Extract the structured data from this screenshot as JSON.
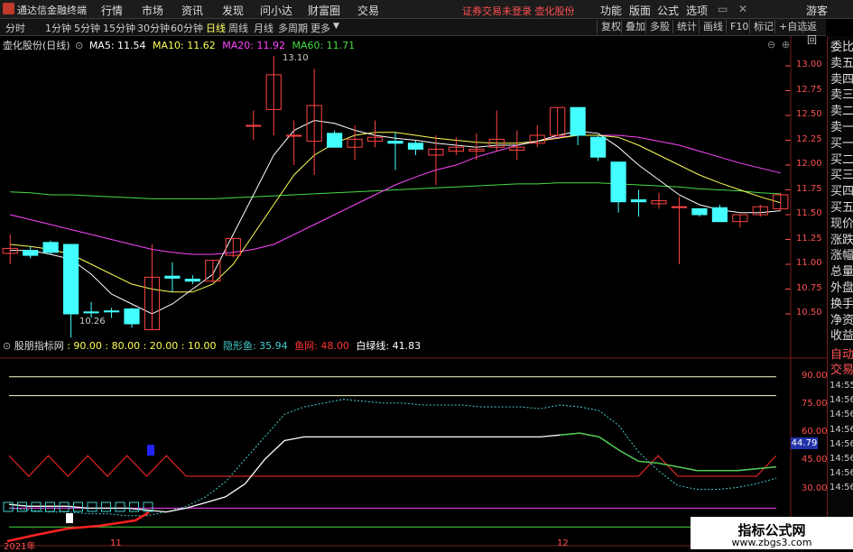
{
  "menubar": {
    "app": "通达信金融终端",
    "items": [
      "行情",
      "市场",
      "资讯",
      "发现",
      "问小达",
      "财富圈",
      "交易"
    ],
    "warning": "证券交易未登录  壶化股份",
    "right": [
      "功能",
      "版面",
      "公式",
      "选项"
    ],
    "guest": "游客"
  },
  "periodbar": {
    "items": [
      "分时",
      "1分钟",
      "5分钟",
      "15分钟",
      "30分钟",
      "60分钟",
      "日线",
      "周线",
      "月线",
      "多周期",
      "更多"
    ],
    "active": "日线",
    "tools": [
      "复权",
      "叠加",
      "多股",
      "统计",
      "画线",
      "F10",
      "标记",
      "+自选",
      "返回"
    ]
  },
  "main_legend": {
    "stock": "壶化股份(日线)",
    "ma5": "MA5: 11.54",
    "ma10": "MA10: 11.62",
    "ma20": "MA20: 11.92",
    "ma60": "MA60: 11.71",
    "hi_label": "13.10",
    "lo_label": "10.26"
  },
  "colors": {
    "up": "#ff4444",
    "down": "#44ffff",
    "ma5": "#ffffff",
    "ma10": "#ffff55",
    "ma20": "#ff44ff",
    "ma60": "#44dd44",
    "bg": "#000000"
  },
  "price_axis": [
    "13.00",
    "12.75",
    "12.50",
    "12.25",
    "12.00",
    "11.75",
    "11.50",
    "11.25",
    "11.00",
    "10.75",
    "10.50"
  ],
  "indicator_legend": {
    "name": "股朋指标网",
    "vals": ": 90.00 : 80.00 : 20.00 : 10.00",
    "yin": "隐形鱼: 35.94",
    "gou": "鱼网: 48.00",
    "bai": "白绿线: 41.83"
  },
  "indicator_axis": [
    "90.00",
    "75.00",
    "60.00",
    "45.00",
    "30.00"
  ],
  "indicator_current": "44.79",
  "date_axis": [
    "2021年",
    "11",
    "12"
  ],
  "rightpanel": [
    "委比",
    "卖五",
    "卖四",
    "卖三",
    "卖二",
    "卖一",
    "买一",
    "买二",
    "买三",
    "买四",
    "买五",
    "现价",
    "涨跌",
    "涨幅",
    "总量",
    "外盘",
    "换手",
    "净资",
    "收益"
  ],
  "rightpanel_bottom": [
    "自动",
    "交易"
  ],
  "rightpanel_times": [
    "14:55",
    "14:56",
    "14:56",
    "14:56",
    "14:56",
    "14:56",
    "14:56",
    "14:56"
  ],
  "watermark": {
    "title": "指标公式网",
    "url": "www.zbgs3.com"
  },
  "chart_data": {
    "type": "candlestick",
    "candles": [
      {
        "o": 11.11,
        "c": 11.16,
        "h": 11.3,
        "l": 11.0
      },
      {
        "o": 11.14,
        "c": 11.09,
        "h": 11.18,
        "l": 11.06
      },
      {
        "o": 11.22,
        "c": 11.12,
        "h": 11.24,
        "l": 11.1
      },
      {
        "o": 11.2,
        "c": 10.5,
        "h": 11.2,
        "l": 10.26
      },
      {
        "o": 10.52,
        "c": 10.51,
        "h": 10.62,
        "l": 10.46
      },
      {
        "o": 10.53,
        "c": 10.52,
        "h": 10.56,
        "l": 10.46
      },
      {
        "o": 10.55,
        "c": 10.4,
        "h": 10.56,
        "l": 10.36
      },
      {
        "o": 10.34,
        "c": 10.87,
        "h": 11.2,
        "l": 10.34
      },
      {
        "o": 10.88,
        "c": 10.86,
        "h": 11.02,
        "l": 10.72
      },
      {
        "o": 10.85,
        "c": 10.83,
        "h": 10.89,
        "l": 10.8
      },
      {
        "o": 10.83,
        "c": 11.04,
        "h": 11.04,
        "l": 10.82
      },
      {
        "o": 11.09,
        "c": 11.26,
        "h": 11.26,
        "l": 11.07
      },
      {
        "o": 12.4,
        "c": 12.4,
        "h": 12.55,
        "l": 12.25
      },
      {
        "o": 12.56,
        "c": 12.91,
        "h": 13.1,
        "l": 12.3
      },
      {
        "o": 12.3,
        "c": 12.3,
        "h": 12.45,
        "l": 12.0
      },
      {
        "o": 12.24,
        "c": 12.6,
        "h": 12.97,
        "l": 11.9
      },
      {
        "o": 12.32,
        "c": 12.18,
        "h": 12.35,
        "l": 12.18
      },
      {
        "o": 12.18,
        "c": 12.26,
        "h": 12.4,
        "l": 12.05
      },
      {
        "o": 12.24,
        "c": 12.28,
        "h": 12.45,
        "l": 12.18
      },
      {
        "o": 12.24,
        "c": 12.22,
        "h": 12.33,
        "l": 11.95
      },
      {
        "o": 12.22,
        "c": 12.16,
        "h": 12.25,
        "l": 12.1
      },
      {
        "o": 12.1,
        "c": 12.16,
        "h": 12.3,
        "l": 11.8
      },
      {
        "o": 12.14,
        "c": 12.18,
        "h": 12.28,
        "l": 12.1
      },
      {
        "o": 12.14,
        "c": 12.16,
        "h": 12.32,
        "l": 12.05
      },
      {
        "o": 12.18,
        "c": 12.26,
        "h": 12.55,
        "l": 12.14
      },
      {
        "o": 12.15,
        "c": 12.18,
        "h": 12.35,
        "l": 12.05
      },
      {
        "o": 12.22,
        "c": 12.3,
        "h": 12.4,
        "l": 12.18
      },
      {
        "o": 12.3,
        "c": 12.58,
        "h": 12.58,
        "l": 12.3
      },
      {
        "o": 12.58,
        "c": 12.3,
        "h": 12.58,
        "l": 12.2
      },
      {
        "o": 12.28,
        "c": 12.08,
        "h": 12.3,
        "l": 12.04
      },
      {
        "o": 12.03,
        "c": 11.63,
        "h": 12.03,
        "l": 11.52
      },
      {
        "o": 11.65,
        "c": 11.63,
        "h": 11.75,
        "l": 11.48
      },
      {
        "o": 11.61,
        "c": 11.64,
        "h": 11.72,
        "l": 11.56
      },
      {
        "o": 11.58,
        "c": 11.58,
        "h": 11.68,
        "l": 11.0
      },
      {
        "o": 11.56,
        "c": 11.5,
        "h": 11.56,
        "l": 11.48
      },
      {
        "o": 11.57,
        "c": 11.43,
        "h": 11.6,
        "l": 11.43
      },
      {
        "o": 11.43,
        "c": 11.5,
        "h": 11.5,
        "l": 11.37
      },
      {
        "o": 11.5,
        "c": 11.58,
        "h": 11.6,
        "l": 11.48
      },
      {
        "o": 11.56,
        "c": 11.7,
        "h": 11.72,
        "l": 11.54
      }
    ],
    "ma5": [
      11.14,
      11.14,
      11.1,
      11.05,
      10.9,
      10.7,
      10.6,
      10.5,
      10.6,
      10.75,
      10.9,
      11.3,
      11.7,
      12.1,
      12.35,
      12.45,
      12.42,
      12.35,
      12.3,
      12.27,
      12.25,
      12.22,
      12.2,
      12.18,
      12.2,
      12.2,
      12.24,
      12.3,
      12.34,
      12.32,
      12.18,
      12.0,
      11.85,
      11.7,
      11.6,
      11.55,
      11.52,
      11.52,
      11.54
    ],
    "ma10": [
      11.2,
      11.18,
      11.15,
      11.1,
      11.0,
      10.9,
      10.8,
      10.75,
      10.72,
      10.72,
      10.8,
      11.0,
      11.3,
      11.6,
      11.9,
      12.1,
      12.22,
      12.3,
      12.33,
      12.33,
      12.3,
      12.27,
      12.25,
      12.23,
      12.22,
      12.22,
      12.24,
      12.27,
      12.3,
      12.3,
      12.28,
      12.2,
      12.1,
      12.0,
      11.9,
      11.82,
      11.75,
      11.68,
      11.62
    ],
    "ma20": [
      11.5,
      11.45,
      11.4,
      11.35,
      11.3,
      11.25,
      11.2,
      11.15,
      11.12,
      11.1,
      11.1,
      11.12,
      11.15,
      11.2,
      11.3,
      11.4,
      11.5,
      11.6,
      11.7,
      11.8,
      11.88,
      11.95,
      12.0,
      12.08,
      12.14,
      12.2,
      12.24,
      12.28,
      12.3,
      12.3,
      12.3,
      12.28,
      12.24,
      12.2,
      12.14,
      12.08,
      12.02,
      11.97,
      11.92
    ],
    "ma60": [
      11.73,
      11.72,
      11.7,
      11.7,
      11.69,
      11.68,
      11.67,
      11.66,
      11.66,
      11.66,
      11.66,
      11.67,
      11.68,
      11.69,
      11.7,
      11.71,
      11.72,
      11.73,
      11.74,
      11.75,
      11.76,
      11.77,
      11.78,
      11.79,
      11.8,
      11.81,
      11.81,
      11.82,
      11.82,
      11.82,
      11.81,
      11.8,
      11.79,
      11.78,
      11.76,
      11.75,
      11.74,
      11.72,
      11.71
    ]
  },
  "indicator_data": {
    "yin": [
      20,
      19,
      18,
      18,
      17,
      17,
      16,
      16,
      18,
      21,
      26,
      34,
      46,
      58,
      70,
      74,
      76,
      78,
      77,
      76,
      76,
      75,
      75,
      75,
      74,
      74,
      74,
      73,
      75,
      74,
      72,
      64,
      50,
      40,
      32,
      30,
      30,
      31,
      33,
      36
    ],
    "white": [
      22,
      21,
      21,
      21,
      20,
      20,
      20,
      19,
      18,
      20,
      23,
      26,
      33,
      46,
      56,
      58,
      58,
      58,
      58,
      58,
      58,
      58,
      58,
      58,
      58,
      58,
      58,
      58,
      59,
      60,
      58,
      51,
      45,
      44,
      42,
      40,
      40,
      40,
      41,
      42
    ],
    "red": [
      48,
      37,
      48,
      37,
      48,
      37,
      48,
      37,
      48,
      37,
      37,
      37,
      37,
      37,
      37,
      37,
      37,
      37,
      37,
      37,
      37,
      37,
      37,
      37,
      37,
      37,
      37,
      37,
      37,
      37,
      37,
      37,
      37,
      48,
      37,
      37,
      37,
      37,
      37,
      48
    ]
  }
}
